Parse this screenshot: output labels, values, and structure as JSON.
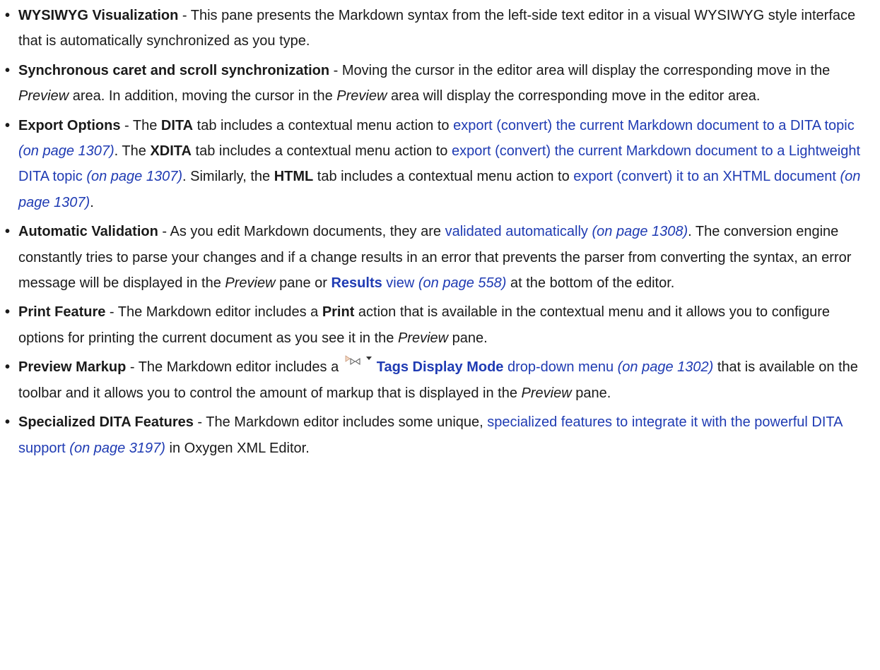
{
  "items": [
    {
      "term": "WYSIWYG Visualization",
      "text": " - This pane presents the Markdown syntax from the left-side text editor in a visual WYSIWYG style interface that is automatically synchronized as you type."
    },
    {
      "term": "Synchronous caret and scroll synchronization",
      "t1": " - Moving the cursor in the editor area will display the corresponding move in the ",
      "e1": "Preview",
      "t2": " area. In addition, moving the cursor in the ",
      "e2": "Preview",
      "t3": " area will display the corresponding move in the editor area."
    },
    {
      "term": "Export Options",
      "t1": " - The ",
      "b1": "DITA",
      "t2": " tab includes a contextual menu action to ",
      "l1": "export (convert) the current Markdown document to a DITA topic",
      "p1": "(on page 1307)",
      "t3": ". The ",
      "b2": "XDITA",
      "t4": " tab includes a contextual menu action to ",
      "l2": "export (convert) the current Markdown document to a Lightweight DITA topic",
      "p2": "(on page 1307)",
      "t5": ". Similarly, the ",
      "b3": "HTML",
      "t6": " tab includes a contextual menu action to ",
      "l3": "export (convert) it to an XHTML document",
      "p3": "(on page 1307)",
      "t7": "."
    },
    {
      "term": "Automatic Validation",
      "t1": " - As you edit Markdown documents, they are ",
      "l1": "validated automatically",
      "p1": "(on page 1308)",
      "t2": ". The conversion engine constantly tries to parse your changes and if a change results in an error that prevents the parser from converting the syntax, an error message will be displayed in the ",
      "e1": "Preview",
      "t3": " pane or ",
      "u1": "Results",
      "l2": " view",
      "p2": "(on page 558)",
      "t4": " at the bottom of the editor."
    },
    {
      "term": "Print Feature",
      "t1": " - The Markdown editor includes a ",
      "b1": "Print",
      "t2": " action that is available in the contextual menu and it allows you to configure options for printing the current document as you see it in the ",
      "e1": "Preview",
      "t3": " pane."
    },
    {
      "term": "Preview Markup",
      "t1": " - The Markdown editor includes a ",
      "icon": "tags-display-mode-icon",
      "u1": "Tags Display Mode",
      "l1": " drop-down menu",
      "p1": "(on page 1302)",
      "t2": " that is available on the toolbar and it allows you to control the amount of markup that is displayed in the ",
      "e1": "Preview",
      "t3": " pane."
    },
    {
      "term": "Specialized DITA Features",
      "t1": " - The Markdown editor includes some unique, ",
      "l1": "specialized features to integrate it with the powerful DITA support",
      "p1": "(on page 3197)",
      "t2": " in Oxygen XML Editor."
    }
  ],
  "colors": {
    "text": "#1a1a1a",
    "link": "#1f3bb3"
  }
}
